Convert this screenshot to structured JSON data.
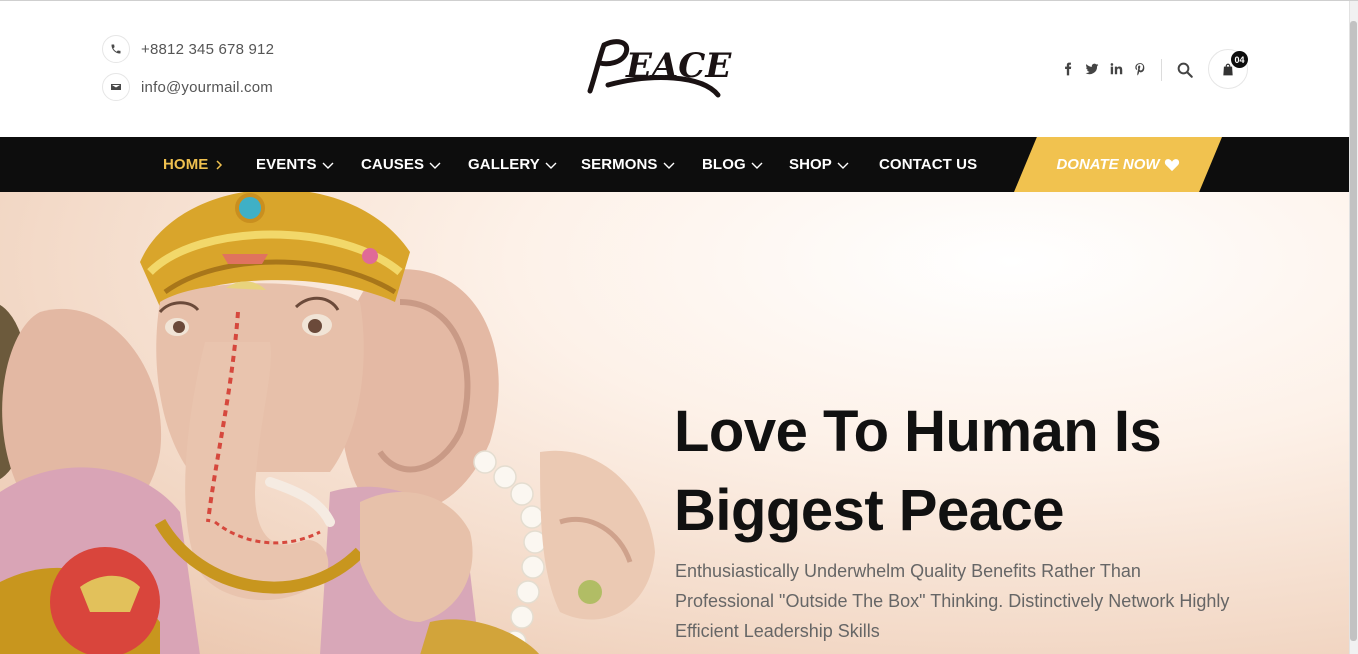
{
  "header": {
    "phone": "+8812 345 678 912",
    "email": "info@yourmail.com",
    "logo_text": "Peace",
    "social_icons": [
      "facebook-icon",
      "twitter-icon",
      "linkedin-icon",
      "pinterest-icon"
    ],
    "cart_count": "04"
  },
  "nav": {
    "items": [
      {
        "label": "HOME"
      },
      {
        "label": "EVENTS"
      },
      {
        "label": "CAUSES"
      },
      {
        "label": "GALLERY"
      },
      {
        "label": "SERMONS"
      },
      {
        "label": "BLOG"
      },
      {
        "label": "SHOP"
      },
      {
        "label": "CONTACT US"
      }
    ],
    "donate_label": "DONATE NOW"
  },
  "hero": {
    "title_line1": "Love To Human Is",
    "title_line2": "Biggest Peace",
    "description": "Enthusiastically Underwhelm Quality Benefits Rather Than Professional \"Outside The Box\" Thinking. Distinctively Network Highly Efficient Leadership Skills"
  },
  "colors": {
    "accent": "#f1c24f",
    "nav_bg": "#0d0d0d",
    "active_nav": "#efc04f"
  }
}
